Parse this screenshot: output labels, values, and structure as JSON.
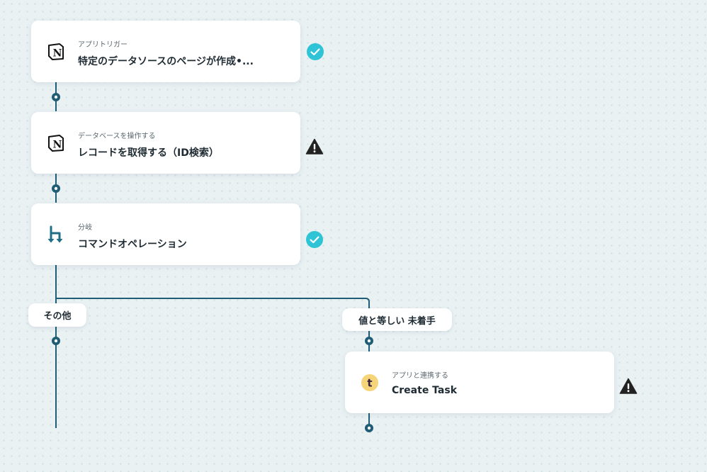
{
  "steps": [
    {
      "sub": "アプリトリガー",
      "title": "特定のデータソースのページが作成•...",
      "app_icon": "notion-icon",
      "status": "success-check-icon"
    },
    {
      "sub": "データベースを操作する",
      "title": "レコードを取得する（ID検索）",
      "app_icon": "notion-icon",
      "status": "warning-icon"
    },
    {
      "sub": "分岐",
      "title": "コマンドオペレーション",
      "app_icon": "branch-icon",
      "status": "success-check-icon"
    },
    {
      "sub": "アプリと連携する",
      "title": "Create Task",
      "app_icon": "task-app-icon",
      "status": "warning-icon"
    }
  ],
  "branches": {
    "other": "その他",
    "equals": "値と等しい 未着手"
  },
  "icon_glyphs": {
    "notion": "N",
    "task_app": "t"
  },
  "colors": {
    "connector": "#1f5c75",
    "success": "#2ec4d6",
    "warning": "#222222",
    "branch_icon": "#1f6d86",
    "task_app_bg": "#f6d57a",
    "task_app_fg": "#3a2340"
  }
}
